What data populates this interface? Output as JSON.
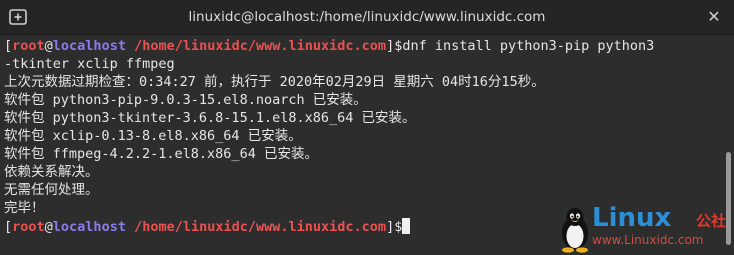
{
  "window": {
    "title": "linuxidc@localhost:/home/linuxidc/www.linuxidc.com",
    "close_glyph": "✕"
  },
  "prompt": {
    "open": "[",
    "user": "root",
    "at": "@",
    "host": "localhost",
    "path": "/home/linuxidc/www.linuxidc.com",
    "close": "]$"
  },
  "command": {
    "part1": "dnf install python3-pip python3",
    "part2": "-tkinter xclip ffmpeg"
  },
  "output": [
    "上次元数据过期检查：0:34:27 前，执行于 2020年02月29日 星期六 04时16分15秒。",
    "软件包 python3-pip-9.0.3-15.el8.noarch 已安装。",
    "软件包 python3-tkinter-3.6.8-15.1.el8.x86_64 已安装。",
    "软件包 xclip-0.13-8.el8.x86_64 已安装。",
    "软件包 ffmpeg-4.2.2-1.el8.x86_64 已安装。",
    "依赖关系解决。",
    "无需任何处理。",
    "完毕！"
  ],
  "watermark": {
    "brand": "Linux",
    "brand_cn": "公社",
    "url": "www.Linuxidc.com"
  },
  "colors": {
    "background": "#2d2d2d",
    "user_and_path": "#ee5050",
    "host": "#8b7bf0",
    "logo_blue": "#2a8fd6"
  },
  "icons": {
    "new_tab": "new-tab-icon",
    "close": "close-icon",
    "logo": "tux-penguin-icon"
  }
}
